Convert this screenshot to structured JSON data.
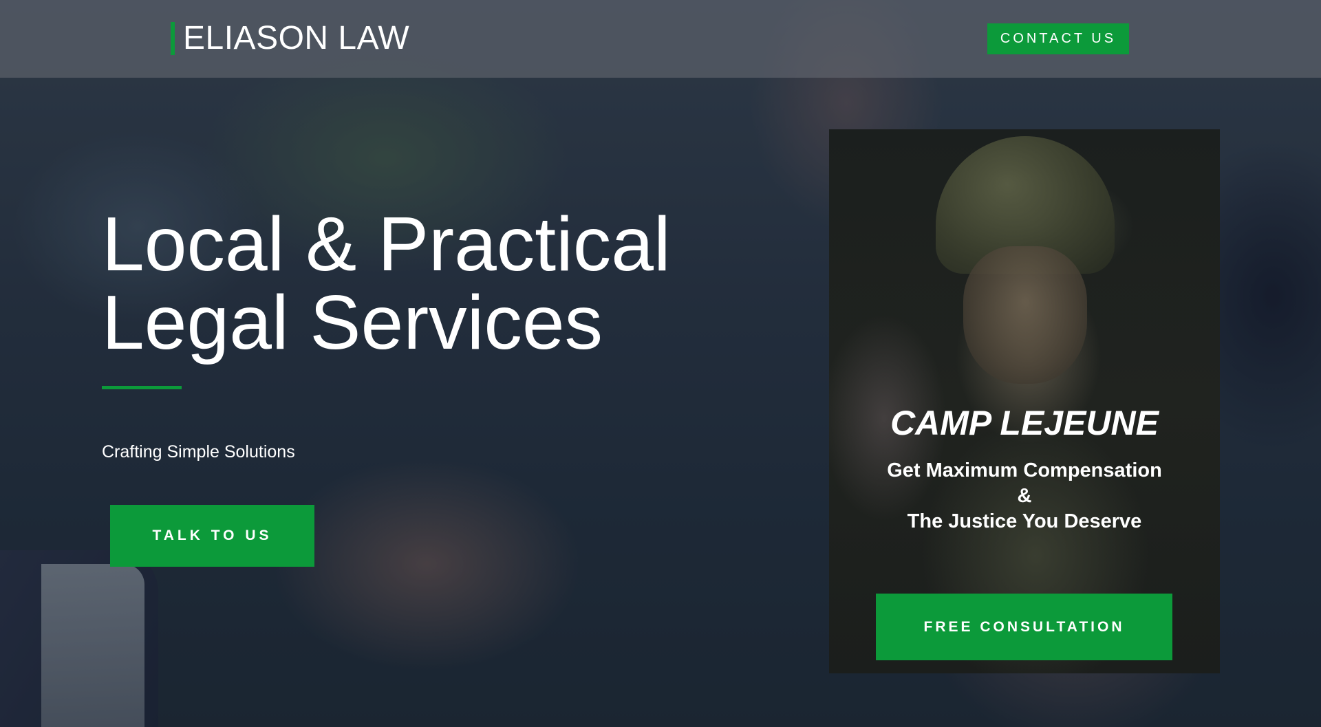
{
  "header": {
    "brand": "ELIASON LAW",
    "contact_label": "CONTACT US"
  },
  "hero": {
    "title_line1": "Local & Practical",
    "title_line2": "Legal Services",
    "subtitle": "Crafting Simple Solutions",
    "cta_label": "TALK TO US"
  },
  "promo": {
    "title": "CAMP LEJEUNE",
    "line1": "Get Maximum Compensation",
    "line2": "&",
    "line3": "The Justice You Deserve",
    "cta_label": "FREE CONSULTATION"
  },
  "colors": {
    "accent": "#0c9a3a",
    "text": "#ffffff",
    "card_bg": "#1c201f"
  }
}
